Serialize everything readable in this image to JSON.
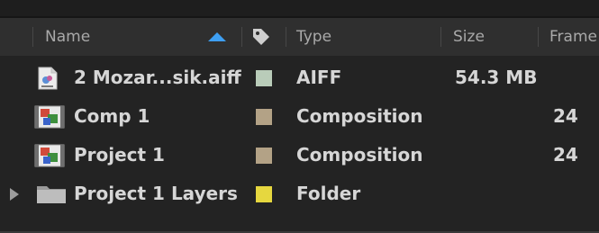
{
  "columns": {
    "name": "Name",
    "type": "Type",
    "size": "Size",
    "frame": "Frame"
  },
  "icons": {
    "sort": "sort-ascending-arrow",
    "label": "tag-icon"
  },
  "items": [
    {
      "name": "2 Mozar...sik.aiff",
      "label_color": "#b9ccb9",
      "type": "AIFF",
      "size": "54.3 MB",
      "frame": "",
      "icon": "audio-file-icon"
    },
    {
      "name": "Comp 1",
      "label_color": "#b3a286",
      "type": "Composition",
      "size": "",
      "frame": "24",
      "icon": "composition-icon"
    },
    {
      "name": "Project 1",
      "label_color": "#b3a286",
      "type": "Composition",
      "size": "",
      "frame": "24",
      "icon": "composition-icon"
    },
    {
      "name": "Project 1 Layers",
      "label_color": "#e6d73f",
      "type": "Folder",
      "size": "",
      "frame": "",
      "icon": "folder-icon"
    }
  ],
  "colors": {
    "accent": "#3e9ff2",
    "panel_bg": "#232323",
    "header_bg": "#2f2f2f"
  }
}
